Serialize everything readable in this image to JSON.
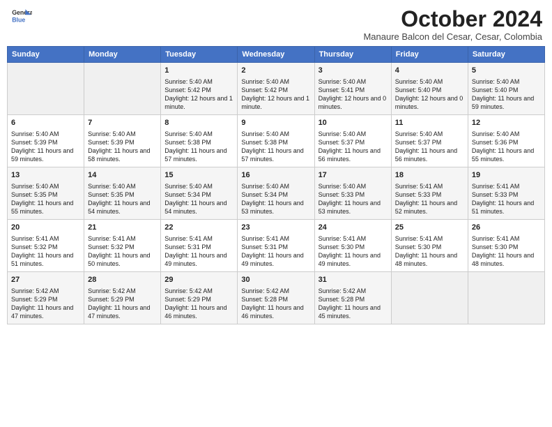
{
  "logo": {
    "line1": "General",
    "line2": "Blue"
  },
  "title": "October 2024",
  "subtitle": "Manaure Balcon del Cesar, Cesar, Colombia",
  "days_of_week": [
    "Sunday",
    "Monday",
    "Tuesday",
    "Wednesday",
    "Thursday",
    "Friday",
    "Saturday"
  ],
  "weeks": [
    [
      {
        "day": "",
        "content": ""
      },
      {
        "day": "",
        "content": ""
      },
      {
        "day": "1",
        "content": "Sunrise: 5:40 AM\nSunset: 5:42 PM\nDaylight: 12 hours and 1 minute."
      },
      {
        "day": "2",
        "content": "Sunrise: 5:40 AM\nSunset: 5:42 PM\nDaylight: 12 hours and 1 minute."
      },
      {
        "day": "3",
        "content": "Sunrise: 5:40 AM\nSunset: 5:41 PM\nDaylight: 12 hours and 0 minutes."
      },
      {
        "day": "4",
        "content": "Sunrise: 5:40 AM\nSunset: 5:40 PM\nDaylight: 12 hours and 0 minutes."
      },
      {
        "day": "5",
        "content": "Sunrise: 5:40 AM\nSunset: 5:40 PM\nDaylight: 11 hours and 59 minutes."
      }
    ],
    [
      {
        "day": "6",
        "content": "Sunrise: 5:40 AM\nSunset: 5:39 PM\nDaylight: 11 hours and 59 minutes."
      },
      {
        "day": "7",
        "content": "Sunrise: 5:40 AM\nSunset: 5:39 PM\nDaylight: 11 hours and 58 minutes."
      },
      {
        "day": "8",
        "content": "Sunrise: 5:40 AM\nSunset: 5:38 PM\nDaylight: 11 hours and 57 minutes."
      },
      {
        "day": "9",
        "content": "Sunrise: 5:40 AM\nSunset: 5:38 PM\nDaylight: 11 hours and 57 minutes."
      },
      {
        "day": "10",
        "content": "Sunrise: 5:40 AM\nSunset: 5:37 PM\nDaylight: 11 hours and 56 minutes."
      },
      {
        "day": "11",
        "content": "Sunrise: 5:40 AM\nSunset: 5:37 PM\nDaylight: 11 hours and 56 minutes."
      },
      {
        "day": "12",
        "content": "Sunrise: 5:40 AM\nSunset: 5:36 PM\nDaylight: 11 hours and 55 minutes."
      }
    ],
    [
      {
        "day": "13",
        "content": "Sunrise: 5:40 AM\nSunset: 5:35 PM\nDaylight: 11 hours and 55 minutes."
      },
      {
        "day": "14",
        "content": "Sunrise: 5:40 AM\nSunset: 5:35 PM\nDaylight: 11 hours and 54 minutes."
      },
      {
        "day": "15",
        "content": "Sunrise: 5:40 AM\nSunset: 5:34 PM\nDaylight: 11 hours and 54 minutes."
      },
      {
        "day": "16",
        "content": "Sunrise: 5:40 AM\nSunset: 5:34 PM\nDaylight: 11 hours and 53 minutes."
      },
      {
        "day": "17",
        "content": "Sunrise: 5:40 AM\nSunset: 5:33 PM\nDaylight: 11 hours and 53 minutes."
      },
      {
        "day": "18",
        "content": "Sunrise: 5:41 AM\nSunset: 5:33 PM\nDaylight: 11 hours and 52 minutes."
      },
      {
        "day": "19",
        "content": "Sunrise: 5:41 AM\nSunset: 5:33 PM\nDaylight: 11 hours and 51 minutes."
      }
    ],
    [
      {
        "day": "20",
        "content": "Sunrise: 5:41 AM\nSunset: 5:32 PM\nDaylight: 11 hours and 51 minutes."
      },
      {
        "day": "21",
        "content": "Sunrise: 5:41 AM\nSunset: 5:32 PM\nDaylight: 11 hours and 50 minutes."
      },
      {
        "day": "22",
        "content": "Sunrise: 5:41 AM\nSunset: 5:31 PM\nDaylight: 11 hours and 49 minutes."
      },
      {
        "day": "23",
        "content": "Sunrise: 5:41 AM\nSunset: 5:31 PM\nDaylight: 11 hours and 49 minutes."
      },
      {
        "day": "24",
        "content": "Sunrise: 5:41 AM\nSunset: 5:30 PM\nDaylight: 11 hours and 49 minutes."
      },
      {
        "day": "25",
        "content": "Sunrise: 5:41 AM\nSunset: 5:30 PM\nDaylight: 11 hours and 48 minutes."
      },
      {
        "day": "26",
        "content": "Sunrise: 5:41 AM\nSunset: 5:30 PM\nDaylight: 11 hours and 48 minutes."
      }
    ],
    [
      {
        "day": "27",
        "content": "Sunrise: 5:42 AM\nSunset: 5:29 PM\nDaylight: 11 hours and 47 minutes."
      },
      {
        "day": "28",
        "content": "Sunrise: 5:42 AM\nSunset: 5:29 PM\nDaylight: 11 hours and 47 minutes."
      },
      {
        "day": "29",
        "content": "Sunrise: 5:42 AM\nSunset: 5:29 PM\nDaylight: 11 hours and 46 minutes."
      },
      {
        "day": "30",
        "content": "Sunrise: 5:42 AM\nSunset: 5:28 PM\nDaylight: 11 hours and 46 minutes."
      },
      {
        "day": "31",
        "content": "Sunrise: 5:42 AM\nSunset: 5:28 PM\nDaylight: 11 hours and 45 minutes."
      },
      {
        "day": "",
        "content": ""
      },
      {
        "day": "",
        "content": ""
      }
    ]
  ]
}
